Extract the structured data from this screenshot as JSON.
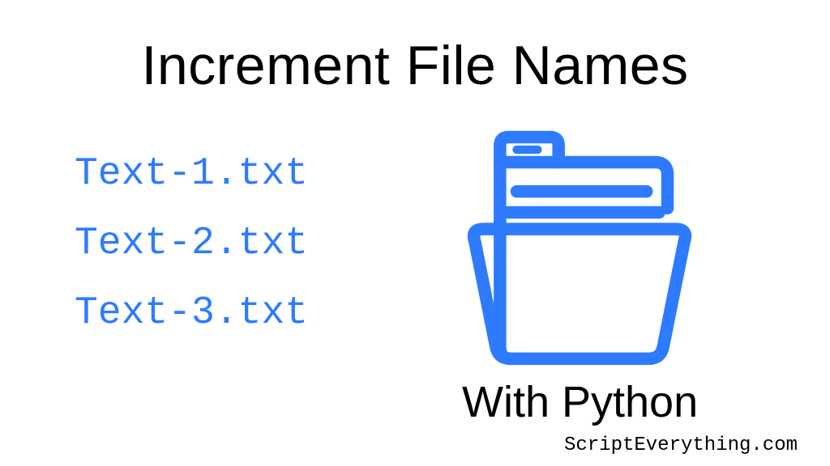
{
  "title": "Increment File Names",
  "files": {
    "item0": "Text-1.txt",
    "item1": "Text-2.txt",
    "item2": "Text-3.txt"
  },
  "subtitle": "With Python",
  "footer": "ScriptEverything.com",
  "colors": {
    "accent": "#2e7bff",
    "text": "#000000",
    "background": "#ffffff"
  }
}
